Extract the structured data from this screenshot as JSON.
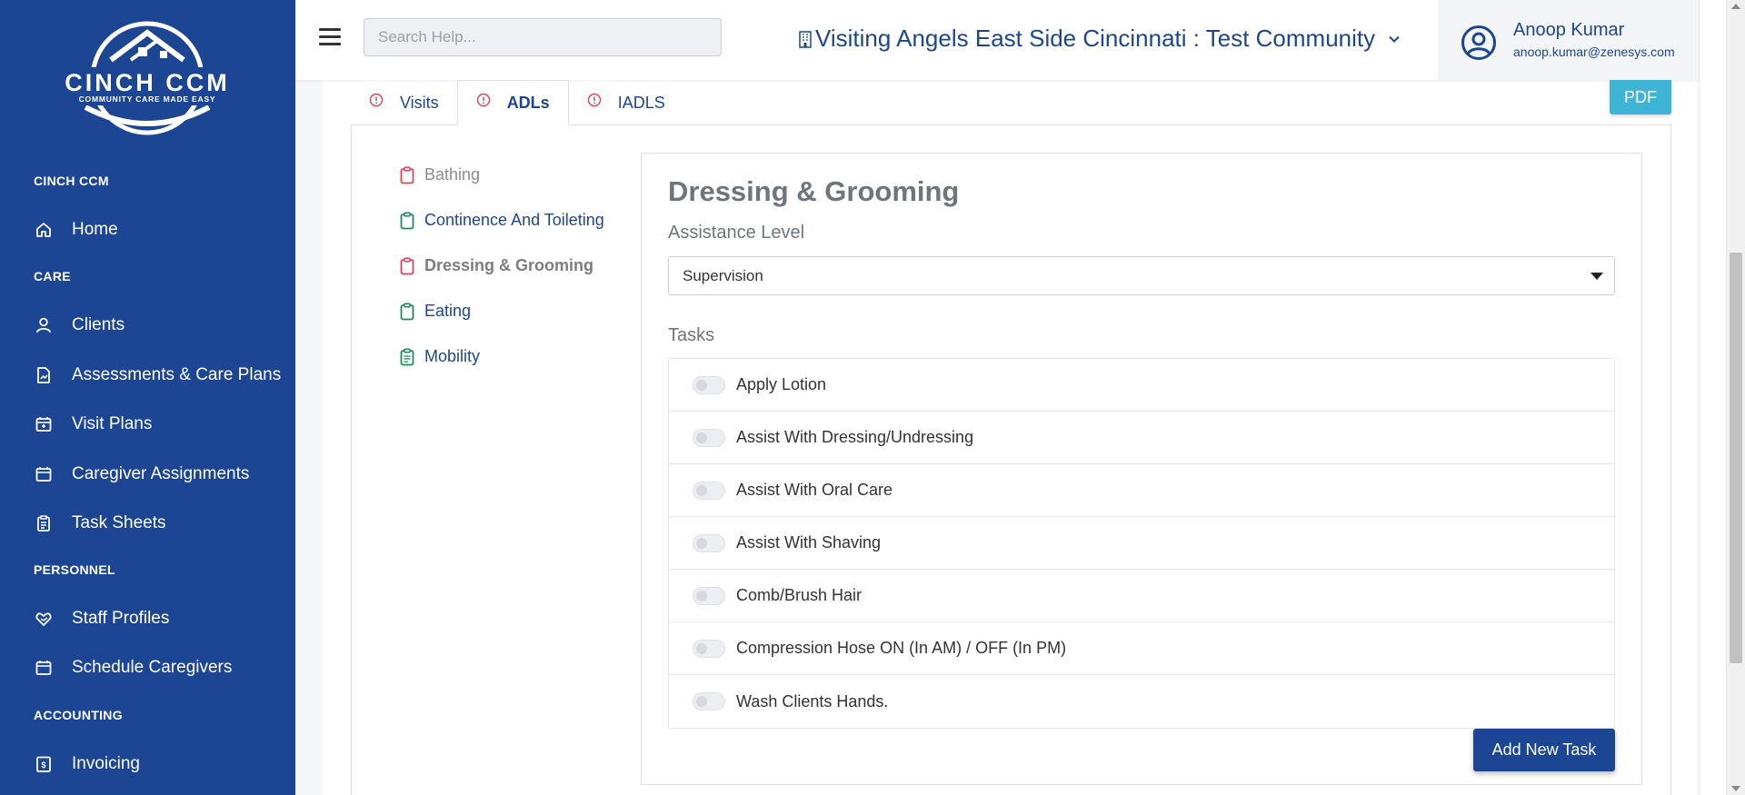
{
  "colors": {
    "sidebar_bg": "#1c4694",
    "brand_blue": "#1c4694",
    "pdf_button": "#3eb5d4",
    "warning_red": "#e4405a",
    "complete_green": "#1e8a5a"
  },
  "sidebar": {
    "logo": {
      "title": "CINCH CCM",
      "tagline": "COMMUNITY CARE MADE EASY"
    },
    "sections": [
      {
        "label": "CINCH CCM"
      },
      {
        "label": "CARE"
      },
      {
        "label": "PERSONNEL"
      },
      {
        "label": "ACCOUNTING"
      }
    ],
    "items": [
      {
        "label": "Home",
        "icon": "home-icon"
      },
      {
        "label": "Clients",
        "icon": "user-icon"
      },
      {
        "label": "Assessments & Care Plans",
        "icon": "document-chart-icon"
      },
      {
        "label": "Visit Plans",
        "icon": "calendar-plan-icon"
      },
      {
        "label": "Caregiver Assignments",
        "icon": "calendar-icon"
      },
      {
        "label": "Task Sheets",
        "icon": "clipboard-icon"
      },
      {
        "label": "Staff Profiles",
        "icon": "heart-hand-icon"
      },
      {
        "label": "Schedule Caregivers",
        "icon": "calendar-icon"
      },
      {
        "label": "Invoicing",
        "icon": "invoice-icon"
      }
    ]
  },
  "header": {
    "search_placeholder": "Search Help...",
    "community": "Visiting Angels East Side Cincinnati : Test Community",
    "user": {
      "name": "Anoop Kumar",
      "email": "anoop.kumar@zenesys.com"
    }
  },
  "tabs": [
    {
      "label": "Visits",
      "active": false
    },
    {
      "label": "ADLs",
      "active": true
    },
    {
      "label": "IADLS",
      "active": false
    }
  ],
  "pdf_label": "PDF",
  "adl_list": [
    {
      "label": "Bathing",
      "status": "incomplete"
    },
    {
      "label": "Continence And Toileting",
      "status": "complete"
    },
    {
      "label": "Dressing & Grooming",
      "status": "active"
    },
    {
      "label": "Eating",
      "status": "complete"
    },
    {
      "label": "Mobility",
      "status": "complete"
    }
  ],
  "detail": {
    "title": "Dressing & Grooming",
    "assistance_label": "Assistance Level",
    "assistance_value": "Supervision",
    "tasks_label": "Tasks",
    "tasks": [
      {
        "label": "Apply Lotion",
        "enabled": false
      },
      {
        "label": "Assist With Dressing/Undressing",
        "enabled": false
      },
      {
        "label": "Assist With Oral Care",
        "enabled": false
      },
      {
        "label": "Assist With Shaving",
        "enabled": false
      },
      {
        "label": "Comb/Brush Hair",
        "enabled": false
      },
      {
        "label": "Compression Hose ON (In AM) / OFF (In PM)",
        "enabled": false
      },
      {
        "label": "Wash Clients Hands.",
        "enabled": false
      }
    ],
    "add_task_label": "Add New Task"
  }
}
